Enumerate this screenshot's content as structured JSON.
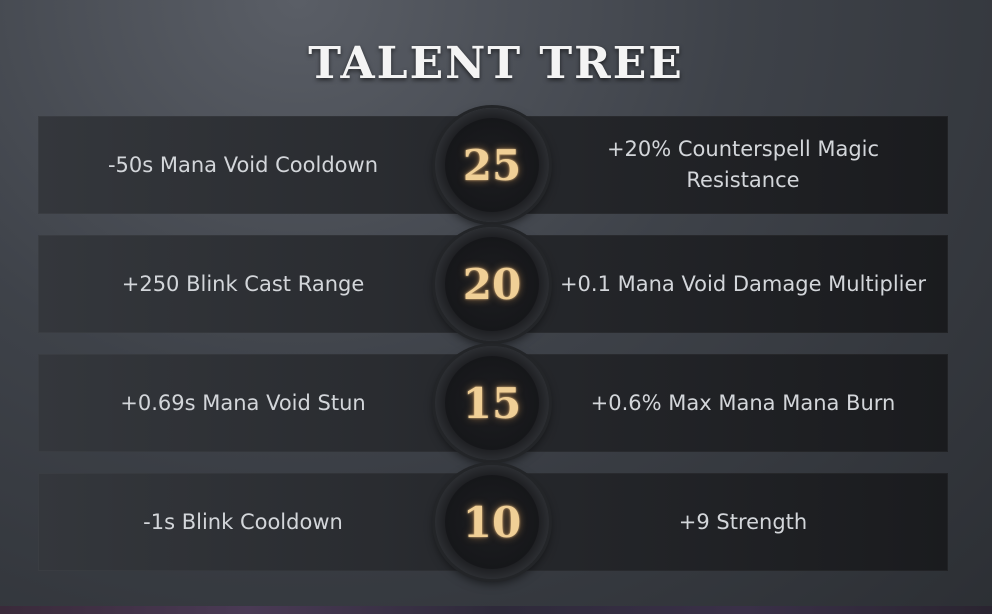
{
  "title": "TALENT TREE",
  "colors": {
    "level_text": "#f0cf96",
    "talent_text": "#d3d6da",
    "title_text": "#f4f4f4"
  },
  "talents": [
    {
      "level": "25",
      "left": "-50s Mana Void Cooldown",
      "right": "+20% Counterspell Magic Resistance"
    },
    {
      "level": "20",
      "left": "+250 Blink Cast Range",
      "right": "+0.1 Mana Void Damage Multiplier"
    },
    {
      "level": "15",
      "left": "+0.69s Mana Void Stun",
      "right": "+0.6% Max Mana Mana Burn"
    },
    {
      "level": "10",
      "left": "-1s Blink Cooldown",
      "right": "+9 Strength"
    }
  ]
}
